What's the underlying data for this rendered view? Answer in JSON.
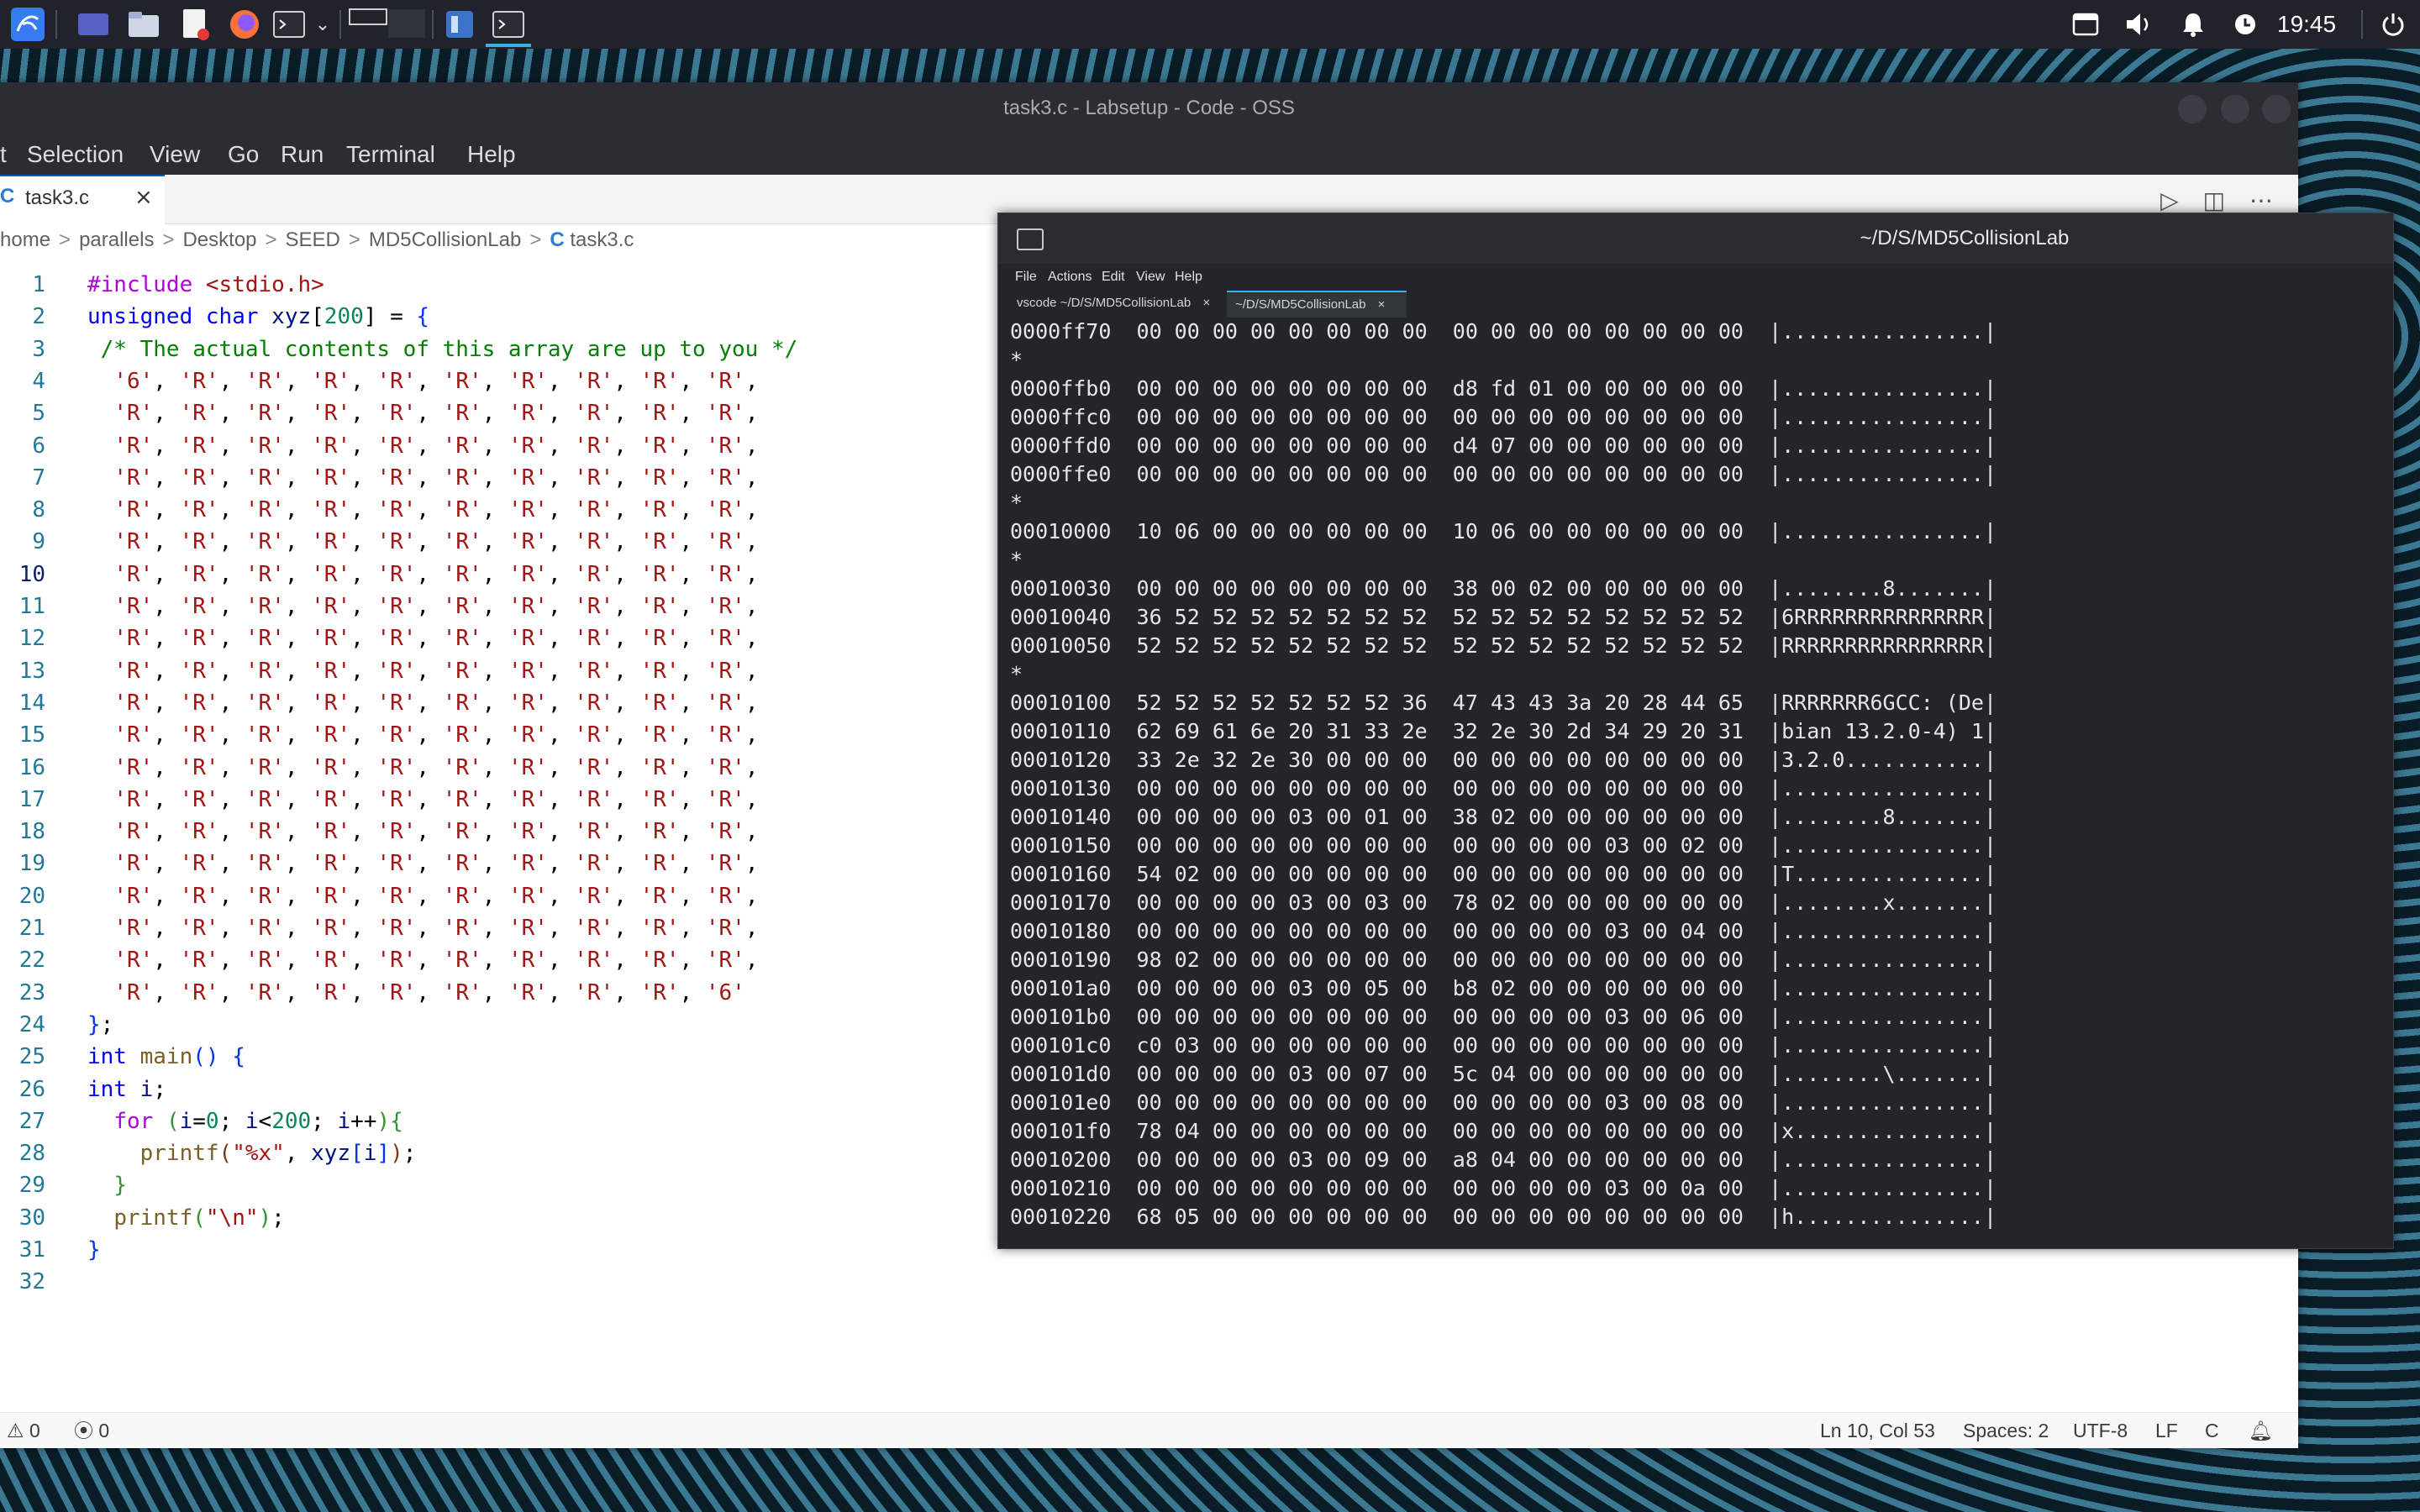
{
  "taskbar": {
    "clock": "19:45",
    "icons": [
      "kali-menu-icon",
      "workspace-icon",
      "file-manager-icon",
      "text-editor-icon",
      "firefox-icon",
      "terminal-icon",
      "chevron-down-icon",
      "window-switcher-icon",
      "code-oss-icon",
      "terminal-task-icon",
      "clipboard-icon",
      "volume-icon",
      "notification-bell-icon",
      "update-icon",
      "power-icon"
    ]
  },
  "vscode": {
    "title": "task3.c - Labsetup - Code - OSS",
    "menu": [
      "t",
      "Selection",
      "View",
      "Go",
      "Run",
      "Terminal",
      "Help"
    ],
    "tab_label": "task3.c",
    "tab_close": "×",
    "tab_icon": "C",
    "breadcrumb": [
      "home",
      "parallels",
      "Desktop",
      "SEED",
      "MD5CollisionLab",
      "task3.c"
    ],
    "breadcrumb_sep": ">",
    "code_lines": [
      {
        "n": "1",
        "html": "<span class='pp'>#include</span> <span class='str'>&lt;stdio.h&gt;</span>"
      },
      {
        "n": "2",
        "html": "<span class='kw'>unsigned</span> <span class='kw'>char</span> <span class='var'>xyz</span>[<span class='num'>200</span>] = <span class='brk1'>{</span>"
      },
      {
        "n": "3",
        "html": " <span class='cm'>/* The actual contents of this array are up to you */</span>"
      },
      {
        "n": "4",
        "html": "  <span class='str'>'6'</span>, <span class='str'>'R'</span>, <span class='str'>'R'</span>, <span class='str'>'R'</span>, <span class='str'>'R'</span>, <span class='str'>'R'</span>, <span class='str'>'R'</span>, <span class='str'>'R'</span>, <span class='str'>'R'</span>, <span class='str'>'R'</span>,"
      },
      {
        "n": "5",
        "html": "R"
      },
      {
        "n": "6",
        "html": "R"
      },
      {
        "n": "7",
        "html": "R"
      },
      {
        "n": "8",
        "html": "R"
      },
      {
        "n": "9",
        "html": "R"
      },
      {
        "n": "10",
        "html": "R"
      },
      {
        "n": "11",
        "html": "R"
      },
      {
        "n": "12",
        "html": "R"
      },
      {
        "n": "13",
        "html": "R"
      },
      {
        "n": "14",
        "html": "R"
      },
      {
        "n": "15",
        "html": "R"
      },
      {
        "n": "16",
        "html": "R"
      },
      {
        "n": "17",
        "html": "R"
      },
      {
        "n": "18",
        "html": "R"
      },
      {
        "n": "19",
        "html": "R"
      },
      {
        "n": "20",
        "html": "R"
      },
      {
        "n": "21",
        "html": "R"
      },
      {
        "n": "22",
        "html": "R"
      },
      {
        "n": "23",
        "html": "  <span class='str'>'R'</span>, <span class='str'>'R'</span>, <span class='str'>'R'</span>, <span class='str'>'R'</span>, <span class='str'>'R'</span>, <span class='str'>'R'</span>, <span class='str'>'R'</span>, <span class='str'>'R'</span>, <span class='str'>'R'</span>, <span class='str'>'6'</span>"
      },
      {
        "n": "24",
        "html": "<span class='brk1'>}</span>;"
      },
      {
        "n": "25",
        "html": "<span class='kw'>int</span> <span class='fn'>main</span><span class='brk1'>()</span> <span class='brk1'>{</span>"
      },
      {
        "n": "26",
        "html": "<span class='kw'>int</span> <span class='var'>i</span>;"
      },
      {
        "n": "27",
        "html": "  <span class='kw' style='color:#af00db'>for</span> <span class='brk2'>(</span><span class='var'>i</span>=<span class='num'>0</span>; <span class='var'>i</span>&lt;<span class='num'>200</span>; <span class='var'>i</span>++<span class='brk2'>){</span>"
      },
      {
        "n": "28",
        "html": "    <span class='fn'>printf</span><span class='brk3'>(</span><span class='str'>\"%x\"</span>, <span class='var'>xyz</span><span class='brk1'>[</span><span class='var'>i</span><span class='brk1'>]</span><span class='brk3'>)</span>;"
      },
      {
        "n": "29",
        "html": "  <span class='brk2'>}</span>"
      },
      {
        "n": "30",
        "html": "  <span class='fn'>printf</span><span class='brk2'>(</span><span class='str'>\"\\n\"</span><span class='brk2'>)</span>;"
      },
      {
        "n": "31",
        "html": "<span class='brk1'>}</span>"
      },
      {
        "n": "32",
        "html": ""
      }
    ],
    "current_line": "10",
    "status": {
      "errors": "0",
      "warnings": "0",
      "position": "Ln 10, Col 53",
      "spaces": "Spaces: 2",
      "encoding": "UTF-8",
      "eol": "LF",
      "language": "C"
    }
  },
  "terminal": {
    "title": "~/D/S/MD5CollisionLab",
    "menu": [
      "File",
      "Actions",
      "Edit",
      "View",
      "Help"
    ],
    "tabs": [
      {
        "label": "vscode ~/D/S/MD5CollisionLab",
        "close": "×",
        "active": false
      },
      {
        "label": "~/D/S/MD5CollisionLab",
        "close": "×",
        "active": true
      }
    ],
    "lines": [
      "0000ff70  00 00 00 00 00 00 00 00  00 00 00 00 00 00 00 00  |................|",
      "*",
      "0000ffb0  00 00 00 00 00 00 00 00  d8 fd 01 00 00 00 00 00  |................|",
      "0000ffc0  00 00 00 00 00 00 00 00  00 00 00 00 00 00 00 00  |................|",
      "0000ffd0  00 00 00 00 00 00 00 00  d4 07 00 00 00 00 00 00  |................|",
      "0000ffe0  00 00 00 00 00 00 00 00  00 00 00 00 00 00 00 00  |................|",
      "*",
      "00010000  10 06 00 00 00 00 00 00  10 06 00 00 00 00 00 00  |................|",
      "*",
      "00010030  00 00 00 00 00 00 00 00  38 00 02 00 00 00 00 00  |........8.......|",
      "00010040  36 52 52 52 52 52 52 52  52 52 52 52 52 52 52 52  |6RRRRRRRRRRRRRRR|",
      "00010050  52 52 52 52 52 52 52 52  52 52 52 52 52 52 52 52  |RRRRRRRRRRRRRRRR|",
      "*",
      "00010100  52 52 52 52 52 52 52 36  47 43 43 3a 20 28 44 65  |RRRRRRR6GCC: (De|",
      "00010110  62 69 61 6e 20 31 33 2e  32 2e 30 2d 34 29 20 31  |bian 13.2.0-4) 1|",
      "00010120  33 2e 32 2e 30 00 00 00  00 00 00 00 00 00 00 00  |3.2.0...........|",
      "00010130  00 00 00 00 00 00 00 00  00 00 00 00 00 00 00 00  |................|",
      "00010140  00 00 00 00 03 00 01 00  38 02 00 00 00 00 00 00  |........8.......|",
      "00010150  00 00 00 00 00 00 00 00  00 00 00 00 03 00 02 00  |................|",
      "00010160  54 02 00 00 00 00 00 00  00 00 00 00 00 00 00 00  |T...............|",
      "00010170  00 00 00 00 03 00 03 00  78 02 00 00 00 00 00 00  |........x.......|",
      "00010180  00 00 00 00 00 00 00 00  00 00 00 00 03 00 04 00  |................|",
      "00010190  98 02 00 00 00 00 00 00  00 00 00 00 00 00 00 00  |................|",
      "000101a0  00 00 00 00 03 00 05 00  b8 02 00 00 00 00 00 00  |................|",
      "000101b0  00 00 00 00 00 00 00 00  00 00 00 00 03 00 06 00  |................|",
      "000101c0  c0 03 00 00 00 00 00 00  00 00 00 00 00 00 00 00  |................|",
      "000101d0  00 00 00 00 03 00 07 00  5c 04 00 00 00 00 00 00  |........\\.......|",
      "000101e0  00 00 00 00 00 00 00 00  00 00 00 00 03 00 08 00  |................|",
      "000101f0  78 04 00 00 00 00 00 00  00 00 00 00 00 00 00 00  |x...............|",
      "00010200  00 00 00 00 03 00 09 00  a8 04 00 00 00 00 00 00  |................|",
      "00010210  00 00 00 00 00 00 00 00  00 00 00 00 03 00 0a 00  |................|",
      "00010220  68 05 00 00 00 00 00 00  00 00 00 00 00 00 00 00  |h...............|"
    ]
  }
}
